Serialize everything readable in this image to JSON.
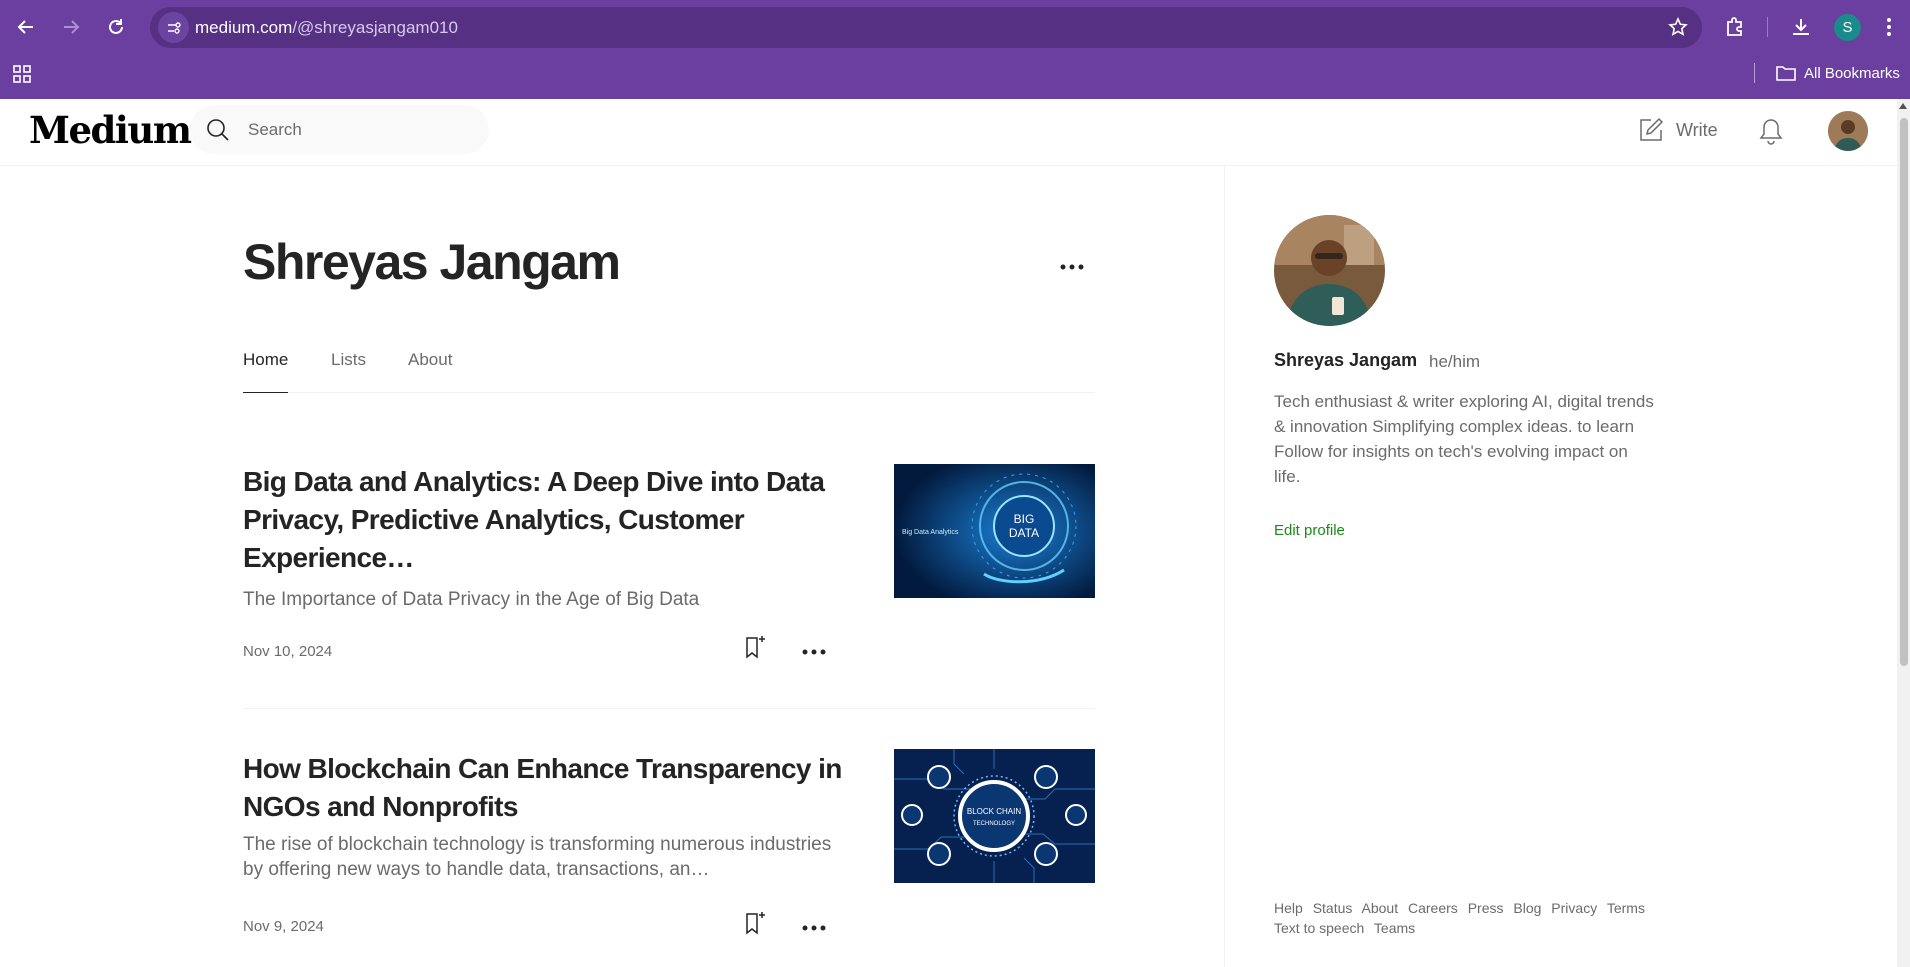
{
  "browser": {
    "url_host": "medium.com",
    "url_path": "/@shreyasjangam010",
    "profile_initial": "S",
    "bookmarks_label": "All Bookmarks",
    "accent_color": "#6b3fa0"
  },
  "header": {
    "logo": "Medium",
    "search_placeholder": "Search",
    "write_label": "Write"
  },
  "profile": {
    "name": "Shreyas Jangam",
    "tabs": [
      {
        "label": "Home",
        "active": true
      },
      {
        "label": "Lists",
        "active": false
      },
      {
        "label": "About",
        "active": false
      }
    ]
  },
  "articles": [
    {
      "title": "Big Data and Analytics: A Deep Dive into Data Privacy, Predictive Analytics, Customer Experience…",
      "subtitle": "The Importance of Data Privacy in the Age of Big Data",
      "date": "Nov 10, 2024",
      "thumb_text_left": "Big Data Analytics",
      "thumb_text_center_1": "BIG",
      "thumb_text_center_2": "DATA"
    },
    {
      "title": "How Blockchain Can Enhance Transparency in NGOs and Nonprofits",
      "subtitle": "The rise of blockchain technology is transforming numerous industries by offering new ways to handle data, transactions, an…",
      "date": "Nov 9, 2024",
      "thumb_text_center_1": "BLOCK CHAIN",
      "thumb_text_center_2": "TECHNOLOGY"
    }
  ],
  "sidebar": {
    "name": "Shreyas Jangam",
    "pronouns": "he/him",
    "bio": "Tech enthusiast & writer exploring AI, digital trends & innovation Simplifying complex ideas. to learn Follow for insights on tech's evolving impact on life.",
    "edit_profile": "Edit profile",
    "footer": [
      "Help",
      "Status",
      "About",
      "Careers",
      "Press",
      "Blog",
      "Privacy",
      "Terms",
      "Text to speech",
      "Teams"
    ]
  }
}
